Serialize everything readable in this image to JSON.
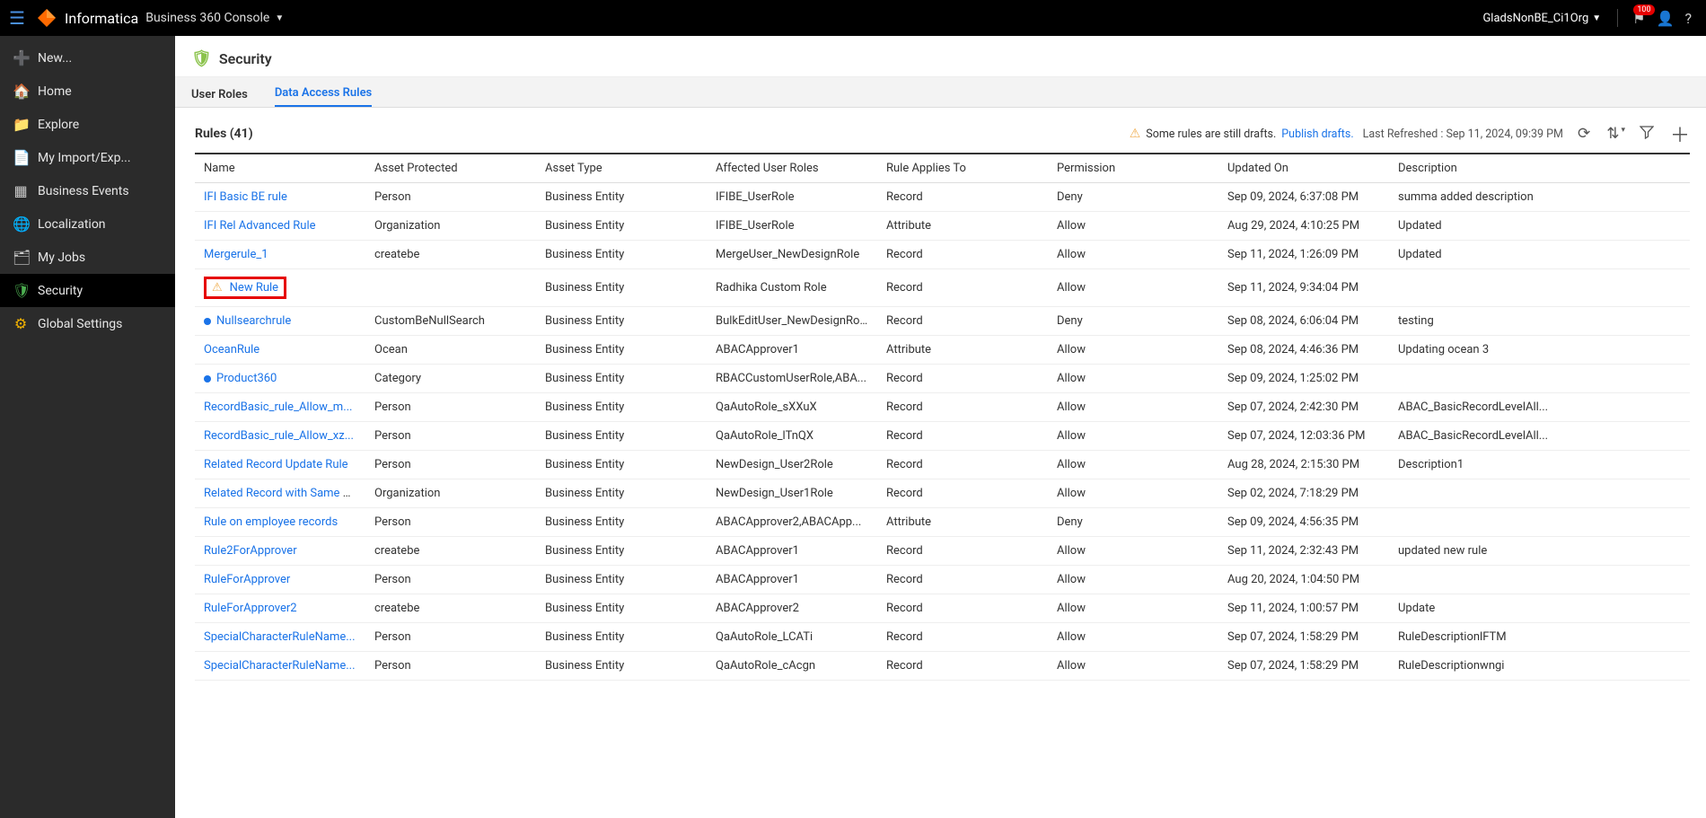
{
  "topbar": {
    "brand": "Informatica",
    "console": "Business 360 Console",
    "org": "GladsNonBE_Ci1Org",
    "notification_count": "100"
  },
  "sidebar": {
    "items": [
      {
        "label": "New...",
        "icon": "➕",
        "icon_color": "#4caf50",
        "name": "new"
      },
      {
        "label": "Home",
        "icon": "🏠",
        "icon_color": "",
        "name": "home"
      },
      {
        "label": "Explore",
        "icon": "📁",
        "icon_color": "#f5b400",
        "name": "explore"
      },
      {
        "label": "My Import/Exp...",
        "icon": "📄",
        "icon_color": "#ccc",
        "name": "import-export"
      },
      {
        "label": "Business Events",
        "icon": "▦",
        "icon_color": "#ccc",
        "name": "business-events"
      },
      {
        "label": "Localization",
        "icon": "🌐",
        "icon_color": "#f5b400",
        "name": "localization"
      },
      {
        "label": "My Jobs",
        "icon": "🗂",
        "icon_color": "#ccc",
        "name": "my-jobs"
      },
      {
        "label": "Security",
        "icon": "🛡",
        "icon_color": "#4caf50",
        "name": "security",
        "active": true
      },
      {
        "label": "Global Settings",
        "icon": "⚙",
        "icon_color": "#f5b400",
        "name": "global-settings"
      }
    ]
  },
  "page": {
    "title": "Security",
    "tabs": {
      "user_roles": "User Roles",
      "data_access": "Data Access Rules",
      "active": "data_access"
    },
    "rules_heading": "Rules (41)",
    "drafts_note": "Some rules are still drafts.",
    "publish": "Publish drafts.",
    "last_refreshed": "Last Refreshed : Sep 11, 2024, 09:39 PM"
  },
  "columns": {
    "name": "Name",
    "asset": "Asset Protected",
    "type": "Asset Type",
    "roles": "Affected User Roles",
    "applies": "Rule Applies To",
    "perm": "Permission",
    "updated": "Updated On",
    "desc": "Description"
  },
  "rows": [
    {
      "name": "IFI Basic BE rule",
      "asset": "Person",
      "type": "Business Entity",
      "roles": "IFIBE_UserRole",
      "applies": "Record",
      "perm": "Deny",
      "updated": "Sep 09, 2024, 6:37:08 PM",
      "desc": "summa added description",
      "status": ""
    },
    {
      "name": "IFI Rel Advanced Rule",
      "asset": "Organization",
      "type": "Business Entity",
      "roles": "IFIBE_UserRole",
      "applies": "Attribute",
      "perm": "Allow",
      "updated": "Aug 29, 2024, 4:10:25 PM",
      "desc": "Updated",
      "status": ""
    },
    {
      "name": "Mergerule_1",
      "asset": "createbe",
      "type": "Business Entity",
      "roles": "MergeUser_NewDesignRole",
      "applies": "Record",
      "perm": "Allow",
      "updated": "Sep 11, 2024, 1:26:09 PM",
      "desc": "Updated",
      "status": ""
    },
    {
      "name": "New Rule",
      "asset": "",
      "type": "Business Entity",
      "roles": "Radhika Custom Role",
      "applies": "Record",
      "perm": "Allow",
      "updated": "Sep 11, 2024, 9:34:04 PM",
      "desc": "",
      "status": "warn",
      "highlight": true
    },
    {
      "name": "Nullsearchrule",
      "asset": "CustomBeNullSearch",
      "type": "Business Entity",
      "roles": "BulkEditUser_NewDesignRole",
      "applies": "Record",
      "perm": "Deny",
      "updated": "Sep 08, 2024, 6:06:04 PM",
      "desc": "testing",
      "status": "dot"
    },
    {
      "name": "OceanRule",
      "asset": "Ocean",
      "type": "Business Entity",
      "roles": "ABACApprover1",
      "applies": "Attribute",
      "perm": "Allow",
      "updated": "Sep 08, 2024, 4:46:36 PM",
      "desc": "Updating ocean 3",
      "status": ""
    },
    {
      "name": "Product360",
      "asset": "Category",
      "type": "Business Entity",
      "roles": "RBACCustomUserRole,ABA...",
      "applies": "Record",
      "perm": "Allow",
      "updated": "Sep 09, 2024, 1:25:02 PM",
      "desc": "",
      "status": "dot"
    },
    {
      "name": "RecordBasic_rule_Allow_m...",
      "asset": "Person",
      "type": "Business Entity",
      "roles": "QaAutoRole_sXXuX",
      "applies": "Record",
      "perm": "Allow",
      "updated": "Sep 07, 2024, 2:42:30 PM",
      "desc": "ABAC_BasicRecordLevelAll...",
      "status": ""
    },
    {
      "name": "RecordBasic_rule_Allow_xz...",
      "asset": "Person",
      "type": "Business Entity",
      "roles": "QaAutoRole_lTnQX",
      "applies": "Record",
      "perm": "Allow",
      "updated": "Sep 07, 2024, 12:03:36 PM",
      "desc": "ABAC_BasicRecordLevelAll...",
      "status": ""
    },
    {
      "name": "Related Record Update Rule",
      "asset": "Person",
      "type": "Business Entity",
      "roles": "NewDesign_User2Role",
      "applies": "Record",
      "perm": "Allow",
      "updated": "Aug 28, 2024, 2:15:30 PM",
      "desc": "Description1",
      "status": ""
    },
    {
      "name": "Related Record with Same e...",
      "asset": "Organization",
      "type": "Business Entity",
      "roles": "NewDesign_User1Role",
      "applies": "Record",
      "perm": "Allow",
      "updated": "Sep 02, 2024, 7:18:29 PM",
      "desc": "",
      "status": ""
    },
    {
      "name": "Rule on employee records",
      "asset": "Person",
      "type": "Business Entity",
      "roles": "ABACApprover2,ABACApp...",
      "applies": "Attribute",
      "perm": "Deny",
      "updated": "Sep 09, 2024, 4:56:35 PM",
      "desc": "",
      "status": ""
    },
    {
      "name": "Rule2ForApprover",
      "asset": "createbe",
      "type": "Business Entity",
      "roles": "ABACApprover1",
      "applies": "Record",
      "perm": "Allow",
      "updated": "Sep 11, 2024, 2:32:43 PM",
      "desc": "updated new rule",
      "status": ""
    },
    {
      "name": "RuleForApprover",
      "asset": "Person",
      "type": "Business Entity",
      "roles": "ABACApprover1",
      "applies": "Record",
      "perm": "Allow",
      "updated": "Aug 20, 2024, 1:04:50 PM",
      "desc": "",
      "status": ""
    },
    {
      "name": "RuleForApprover2",
      "asset": "createbe",
      "type": "Business Entity",
      "roles": "ABACApprover2",
      "applies": "Record",
      "perm": "Allow",
      "updated": "Sep 11, 2024, 1:00:57 PM",
      "desc": "Update",
      "status": ""
    },
    {
      "name": "SpecialCharacterRuleName...",
      "asset": "Person",
      "type": "Business Entity",
      "roles": "QaAutoRole_LCATi",
      "applies": "Record",
      "perm": "Allow",
      "updated": "Sep 07, 2024, 1:58:29 PM",
      "desc": "RuleDescriptionlFTM",
      "status": ""
    },
    {
      "name": "SpecialCharacterRuleName...",
      "asset": "Person",
      "type": "Business Entity",
      "roles": "QaAutoRole_cAcgn",
      "applies": "Record",
      "perm": "Allow",
      "updated": "Sep 07, 2024, 1:58:29 PM",
      "desc": "RuleDescriptionwngi",
      "status": ""
    }
  ]
}
